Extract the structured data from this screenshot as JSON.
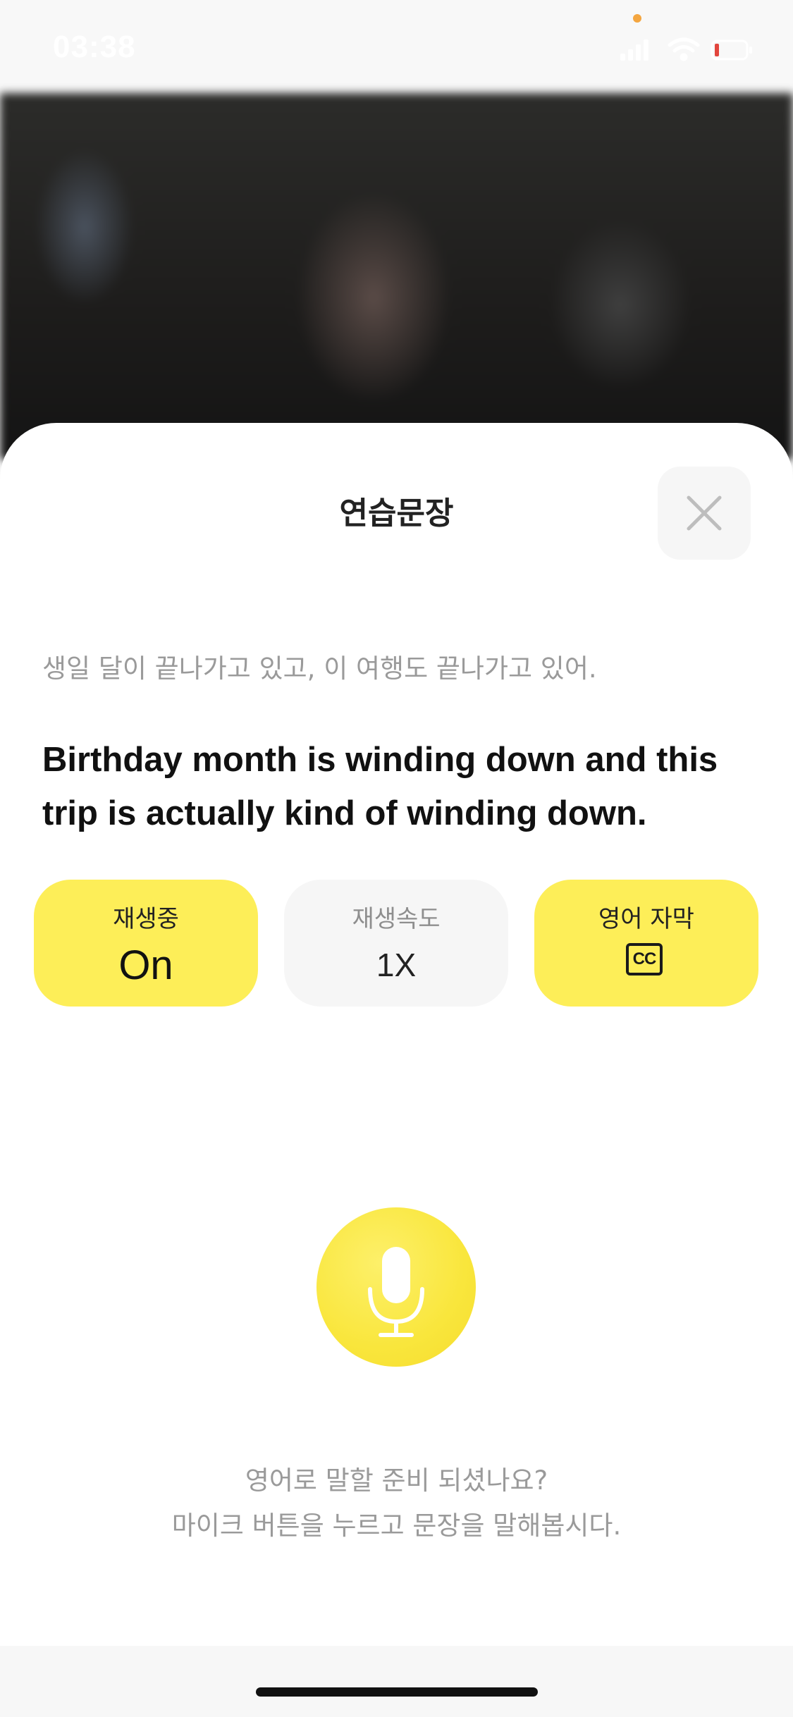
{
  "status_bar": {
    "time": "03:38"
  },
  "sheet": {
    "title": "연습문장",
    "korean_sentence": "생일 달이 끝나가고 있고, 이 여행도 끝나가고 있어.",
    "english_sentence": "Birthday month is winding down and this trip is actually kind of winding down.",
    "controls": {
      "playback": {
        "label": "재생중",
        "value": "On"
      },
      "speed": {
        "label": "재생속도",
        "value": "1X"
      },
      "subtitles": {
        "label": "영어 자막",
        "icon_text": "CC"
      }
    },
    "prompt_line1": "영어로 말할 준비 되셨나요?",
    "prompt_line2": "마이크 버튼을 누르고 문장을 말해봅시다."
  },
  "colors": {
    "accent": "#fdee58",
    "mic": "#f9e63c",
    "muted_text": "#9a9a9a"
  },
  "icons": [
    "close-icon",
    "microphone-icon",
    "closed-caption-icon",
    "signal-icon",
    "wifi-icon",
    "battery-icon"
  ]
}
